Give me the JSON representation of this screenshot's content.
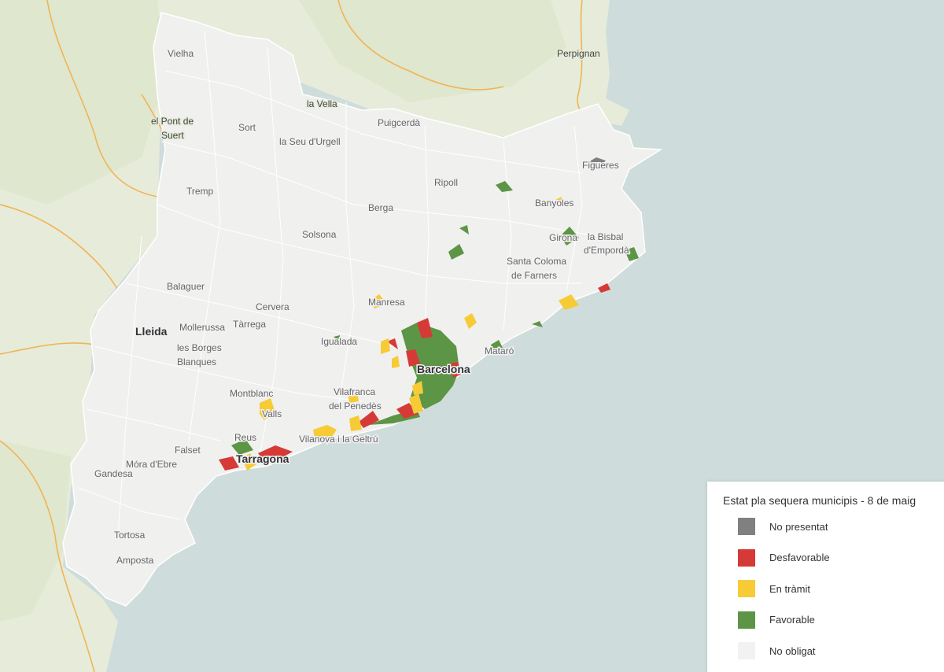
{
  "map": {
    "places": [
      {
        "name": "Vielha",
        "cls": ""
      },
      {
        "name": "Perpignan",
        "cls": "ext"
      },
      {
        "name": "Puigcerdà",
        "cls": ""
      },
      {
        "name": "el Pont de",
        "cls": "ext"
      },
      {
        "name": "Suert",
        "cls": "ext"
      },
      {
        "name": "Sort",
        "cls": ""
      },
      {
        "name": "la Seu d'Urgell",
        "cls": ""
      },
      {
        "name": "Tremp",
        "cls": ""
      },
      {
        "name": "Ripoll",
        "cls": ""
      },
      {
        "name": "Figueres",
        "cls": ""
      },
      {
        "name": "Berga",
        "cls": ""
      },
      {
        "name": "Banyoles",
        "cls": ""
      },
      {
        "name": "Solsona",
        "cls": ""
      },
      {
        "name": "Girona",
        "cls": ""
      },
      {
        "name": "la Bisbal",
        "cls": ""
      },
      {
        "name": "d'Empordà",
        "cls": ""
      },
      {
        "name": "Santa Coloma",
        "cls": ""
      },
      {
        "name": "de Farners",
        "cls": ""
      },
      {
        "name": "Balaguer",
        "cls": ""
      },
      {
        "name": "Cervera",
        "cls": ""
      },
      {
        "name": "Manresa",
        "cls": ""
      },
      {
        "name": "Lleida",
        "cls": "big"
      },
      {
        "name": "Mollerussa",
        "cls": ""
      },
      {
        "name": "Tàrrega",
        "cls": ""
      },
      {
        "name": "Igualada",
        "cls": ""
      },
      {
        "name": "les Borges",
        "cls": ""
      },
      {
        "name": "Blanques",
        "cls": ""
      },
      {
        "name": "Mataró",
        "cls": ""
      },
      {
        "name": "Barcelona",
        "cls": "big"
      },
      {
        "name": "Montblanc",
        "cls": ""
      },
      {
        "name": "Vilafranca",
        "cls": ""
      },
      {
        "name": "del Penedès",
        "cls": ""
      },
      {
        "name": "Valls",
        "cls": ""
      },
      {
        "name": "Vilanova i la Geltrú",
        "cls": ""
      },
      {
        "name": "Falset",
        "cls": ""
      },
      {
        "name": "Reus",
        "cls": ""
      },
      {
        "name": "Móra d'Ebre",
        "cls": ""
      },
      {
        "name": "Gandesa",
        "cls": ""
      },
      {
        "name": "Tarragona",
        "cls": "big"
      },
      {
        "name": "Tortosa",
        "cls": ""
      },
      {
        "name": "Amposta",
        "cls": ""
      },
      {
        "name": "la Vella",
        "cls": "ext"
      }
    ]
  },
  "legend": {
    "title": "Estat pla sequera municipis - 8 de maig",
    "items": [
      {
        "label": "No presentat",
        "color": "#808080"
      },
      {
        "label": "Desfavorable",
        "color": "#d63a37"
      },
      {
        "label": "En tràmit",
        "color": "#f7cb35"
      },
      {
        "label": "Favorable",
        "color": "#5c9545"
      },
      {
        "label": "No obligat",
        "color": "#f2f2f2"
      }
    ]
  }
}
